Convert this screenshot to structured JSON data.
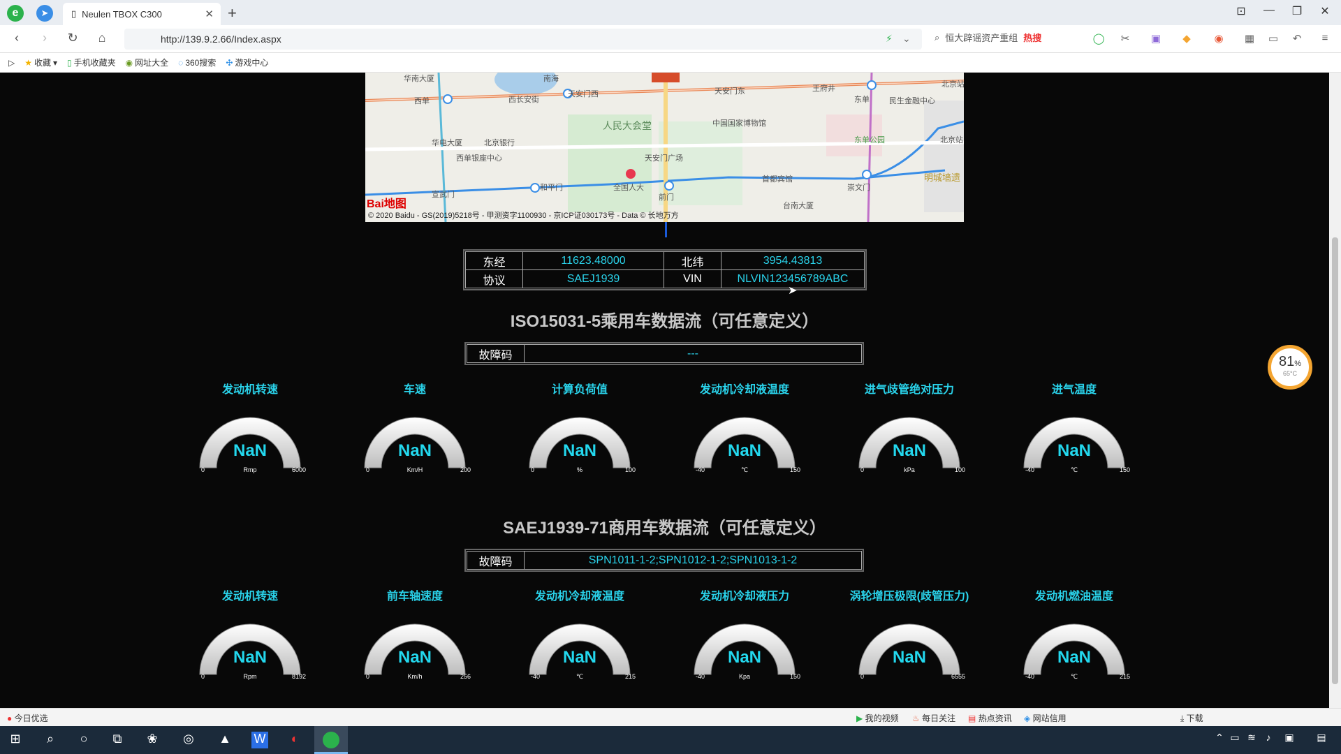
{
  "browser": {
    "tab_title": "Neulen TBOX C300",
    "url": "http://139.9.2.66/Index.aspx",
    "search_text": "恒大辟谣资产重组",
    "hot_label": "热搜",
    "bookmarks": [
      "收藏",
      "手机收藏夹",
      "网址大全",
      "360搜索",
      "游戏中心"
    ]
  },
  "map": {
    "copyright": "© 2020 Baidu - GS(2019)5218号 - 甲测资字1100930 - 京ICP证030173号 - Data © 长地万方",
    "logo": "Bai地图",
    "labels": [
      "华南大厦",
      "南海",
      "西单",
      "西长安街",
      "天安门西",
      "天安门东",
      "王府井",
      "东单",
      "北京站",
      "民生金融中心",
      "人民大会堂",
      "中国国家博物馆",
      "华电大厦",
      "北京银行",
      "西单银座中心",
      "天安门广场",
      "东单公园",
      "和平门",
      "全国人大",
      "前门",
      "首都宾馆",
      "崇文门",
      "明城墙遗",
      "宣武门",
      "台南大厦",
      "北京站"
    ]
  },
  "info": {
    "lon_label": "东经",
    "lon_value": "11623.48000",
    "lat_label": "北纬",
    "lat_value": "3954.43813",
    "proto_label": "协议",
    "proto_value": "SAEJ1939",
    "vin_label": "VIN",
    "vin_value": "NLVIN123456789ABC"
  },
  "section1": {
    "title": "ISO15031-5乘用车数据流（可任意定义）",
    "fault_label": "故障码",
    "fault_value": "---",
    "gauges": [
      {
        "title": "发动机转速",
        "value": "NaN",
        "min": "0",
        "max": "6000",
        "unit": "Rmp"
      },
      {
        "title": "车速",
        "value": "NaN",
        "min": "0",
        "max": "200",
        "unit": "Km/H"
      },
      {
        "title": "计算负荷值",
        "value": "NaN",
        "min": "0",
        "max": "100",
        "unit": "%"
      },
      {
        "title": "发动机冷却液温度",
        "value": "NaN",
        "min": "-40",
        "max": "150",
        "unit": "℃"
      },
      {
        "title": "进气歧管绝对压力",
        "value": "NaN",
        "min": "0",
        "max": "100",
        "unit": "kPa"
      },
      {
        "title": "进气温度",
        "value": "NaN",
        "min": "-40",
        "max": "150",
        "unit": "℃"
      }
    ]
  },
  "section2": {
    "title": "SAEJ1939-71商用车数据流（可任意定义）",
    "fault_label": "故障码",
    "fault_value": "SPN1011-1-2;SPN1012-1-2;SPN1013-1-2",
    "gauges": [
      {
        "title": "发动机转速",
        "value": "NaN",
        "min": "0",
        "max": "8192",
        "unit": "Rpm"
      },
      {
        "title": "前车轴速度",
        "value": "NaN",
        "min": "0",
        "max": "256",
        "unit": "Km/h"
      },
      {
        "title": "发动机冷却液温度",
        "value": "NaN",
        "min": "-40",
        "max": "215",
        "unit": "℃"
      },
      {
        "title": "发动机冷却液压力",
        "value": "NaN",
        "min": "-40",
        "max": "150",
        "unit": "Kpa"
      },
      {
        "title": "涡轮增压极限(歧管压力)",
        "value": "NaN",
        "min": "0",
        "max": "6555",
        "unit": ""
      },
      {
        "title": "发动机燃油温度",
        "value": "NaN",
        "min": "-40",
        "max": "215",
        "unit": "℃"
      }
    ]
  },
  "badge": {
    "percent": "81",
    "percent_sign": "%",
    "temp": "65°C"
  },
  "statusbar": {
    "left": "今日优选",
    "items": [
      "我的视频",
      "每日关注",
      "热点资讯",
      "网站信用",
      "下载"
    ]
  },
  "colors": {
    "accent": "#2ad4ec",
    "page_bg": "#080808",
    "title": "#c8c8c8"
  }
}
